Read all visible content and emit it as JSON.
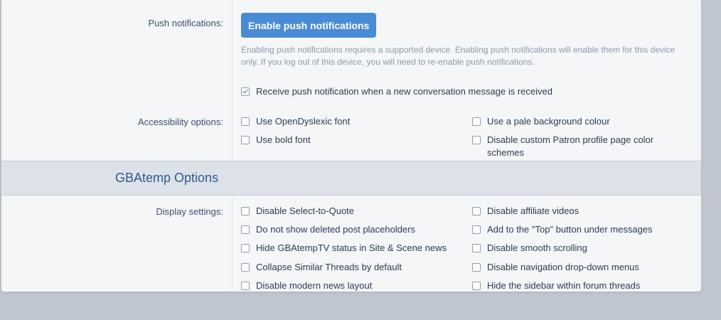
{
  "push": {
    "label": "Push notifications:",
    "button_label": "Enable push notifications",
    "hint": "Enabling push notifications requires a supported device. Enabling push notifications will enable them for this device only. If you log out of this device, you will need to re-enable push notifications.",
    "conversation_option": {
      "label": "Receive push notification when a new conversation message is received",
      "checked": true
    }
  },
  "accessibility": {
    "label": "Accessibility options:",
    "options": [
      {
        "label": "Use OpenDyslexic font",
        "checked": false
      },
      {
        "label": "Use a pale background colour",
        "checked": false
      },
      {
        "label": "Use bold font",
        "checked": false
      },
      {
        "label": "Disable custom Patron profile page color schemes",
        "checked": false
      }
    ]
  },
  "gbatemp": {
    "section_title": "GBAtemp Options",
    "display_label": "Display settings:",
    "options": [
      {
        "label": "Disable Select-to-Quote",
        "checked": false
      },
      {
        "label": "Disable affiliate videos",
        "checked": false
      },
      {
        "label": "Do not show deleted post placeholders",
        "checked": false
      },
      {
        "label": "Add to the \"Top\" button under messages",
        "checked": false
      },
      {
        "label": "Hide GBAtempTV status in Site & Scene news",
        "checked": false
      },
      {
        "label": "Disable smooth scrolling",
        "checked": false
      },
      {
        "label": "Collapse Similar Threads by default",
        "checked": false
      },
      {
        "label": "Disable navigation drop-down menus",
        "checked": false
      },
      {
        "label": "Disable modern news layout",
        "checked": false
      },
      {
        "label": "Hide the sidebar within forum threads",
        "checked": false
      }
    ]
  },
  "colors": {
    "button": "#4a8bd6",
    "section_title": "#2f5a8e",
    "page_background": "#c0c6d0"
  }
}
